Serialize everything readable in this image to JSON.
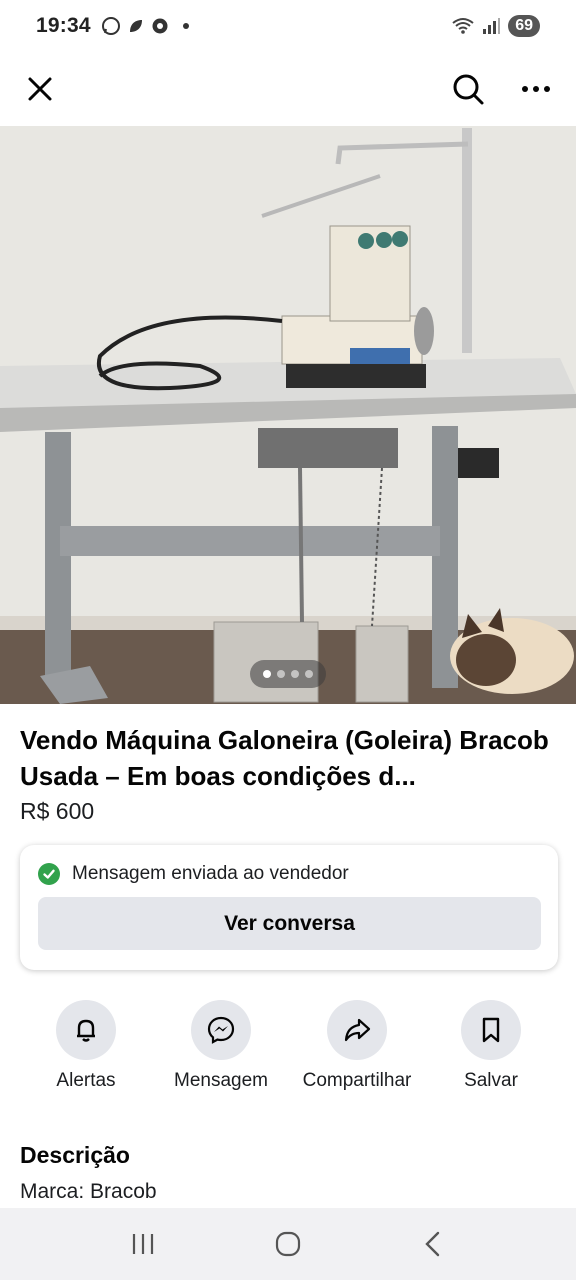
{
  "status_bar": {
    "time": "19:34",
    "battery": "69",
    "icons": [
      "whatsapp-icon",
      "leaf-icon",
      "chrome-icon",
      "wifi-icon",
      "signal-icon"
    ]
  },
  "top_bar": {
    "close_icon": "close-icon",
    "search_icon": "search-icon",
    "more_icon": "more-icon"
  },
  "photo": {
    "carousel_total": 4,
    "carousel_active": 1
  },
  "listing": {
    "title": "Vendo Máquina Galoneira (Goleira) Bracob Usada – Em boas condições d...",
    "price": "R$ 600"
  },
  "message_card": {
    "status": "Mensagem enviada ao vendedor",
    "button": "Ver conversa"
  },
  "actions": [
    {
      "label": "Alertas",
      "icon": "bell-icon"
    },
    {
      "label": "Mensagem",
      "icon": "messenger-icon"
    },
    {
      "label": "Compartilhar",
      "icon": "share-icon"
    },
    {
      "label": "Salvar",
      "icon": "bookmark-icon"
    }
  ],
  "description": {
    "heading": "Descrição",
    "brand": "Marca: Bracob"
  },
  "colors": {
    "accent_green": "#31a24c",
    "button_gray": "#e4e6eb"
  }
}
